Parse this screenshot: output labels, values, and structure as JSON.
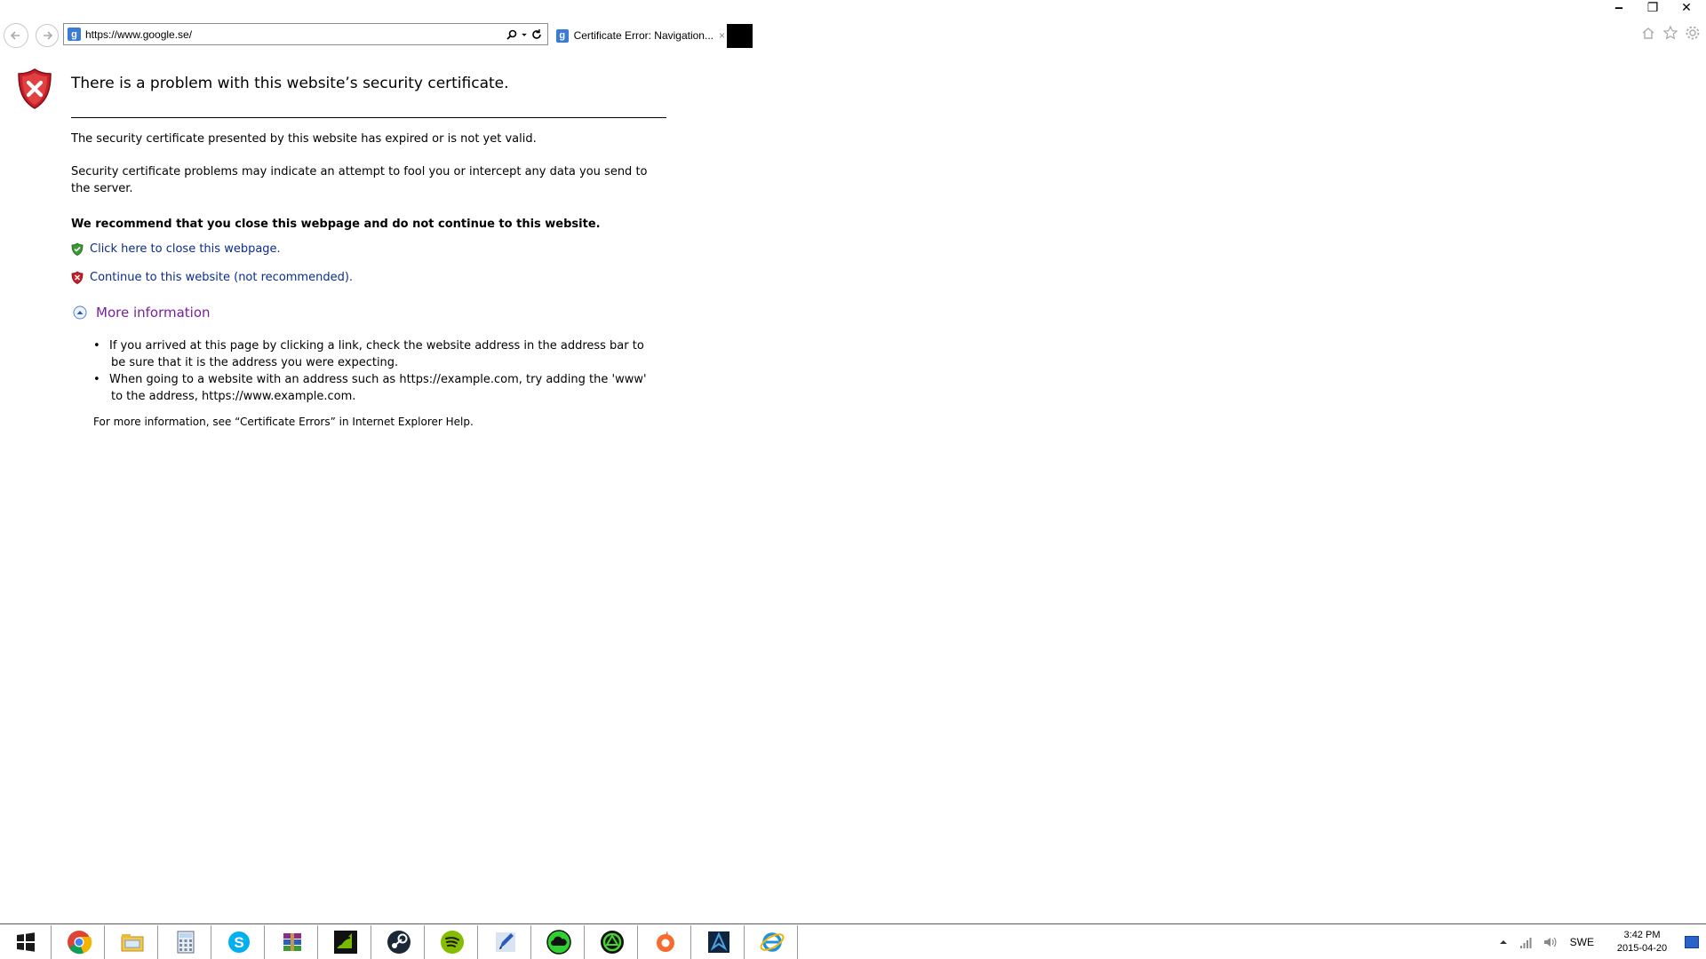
{
  "browser": {
    "address_url": "https://www.google.se/",
    "tab_title": "Certificate Error: Navigation...",
    "tab_close": "×",
    "favicon_letter": "g",
    "window_controls": {
      "minimize": "‒",
      "restore": "❐",
      "close": "✕"
    }
  },
  "error_page": {
    "title": "There is a problem with this website’s security certificate.",
    "message_1": "The security certificate presented by this website has expired or is not yet valid.",
    "message_2": "Security certificate problems may indicate an attempt to fool you or intercept any data you send to the server.",
    "recommendation": "We recommend that you close this webpage and do not continue to this website.",
    "close_link": "Click here to close this webpage.",
    "continue_link": "Continue to this website (not recommended).",
    "more_info_label": "More information",
    "more_info_items": [
      "If you arrived at this page by clicking a link, check the website address in the address bar to be sure that it is the address you were expecting.",
      "When going to a website with an address such as https://example.com, try adding the 'www' to the address, https://www.example.com."
    ],
    "help_note": "For more information, see “Certificate Errors” in Internet Explorer Help."
  },
  "taskbar": {
    "items": [
      "windows-start-icon",
      "chrome-icon",
      "file-explorer-icon",
      "calculator-icon",
      "skype-icon",
      "winrar-icon",
      "nvidia-icon",
      "steam-icon",
      "spotify-icon",
      "pen-app-icon",
      "cloud-app-icon",
      "razer-icon",
      "origin-icon",
      "game-app-icon",
      "internet-explorer-icon"
    ],
    "tray_language": "SWE",
    "clock_time": "3:42 PM",
    "clock_date": "2015-04-20"
  },
  "colors": {
    "link_blue": "#0b2b8c",
    "more_info_purple": "#7a1ea0",
    "shield_red": "#c8202a",
    "shield_green": "#3a9a36"
  }
}
